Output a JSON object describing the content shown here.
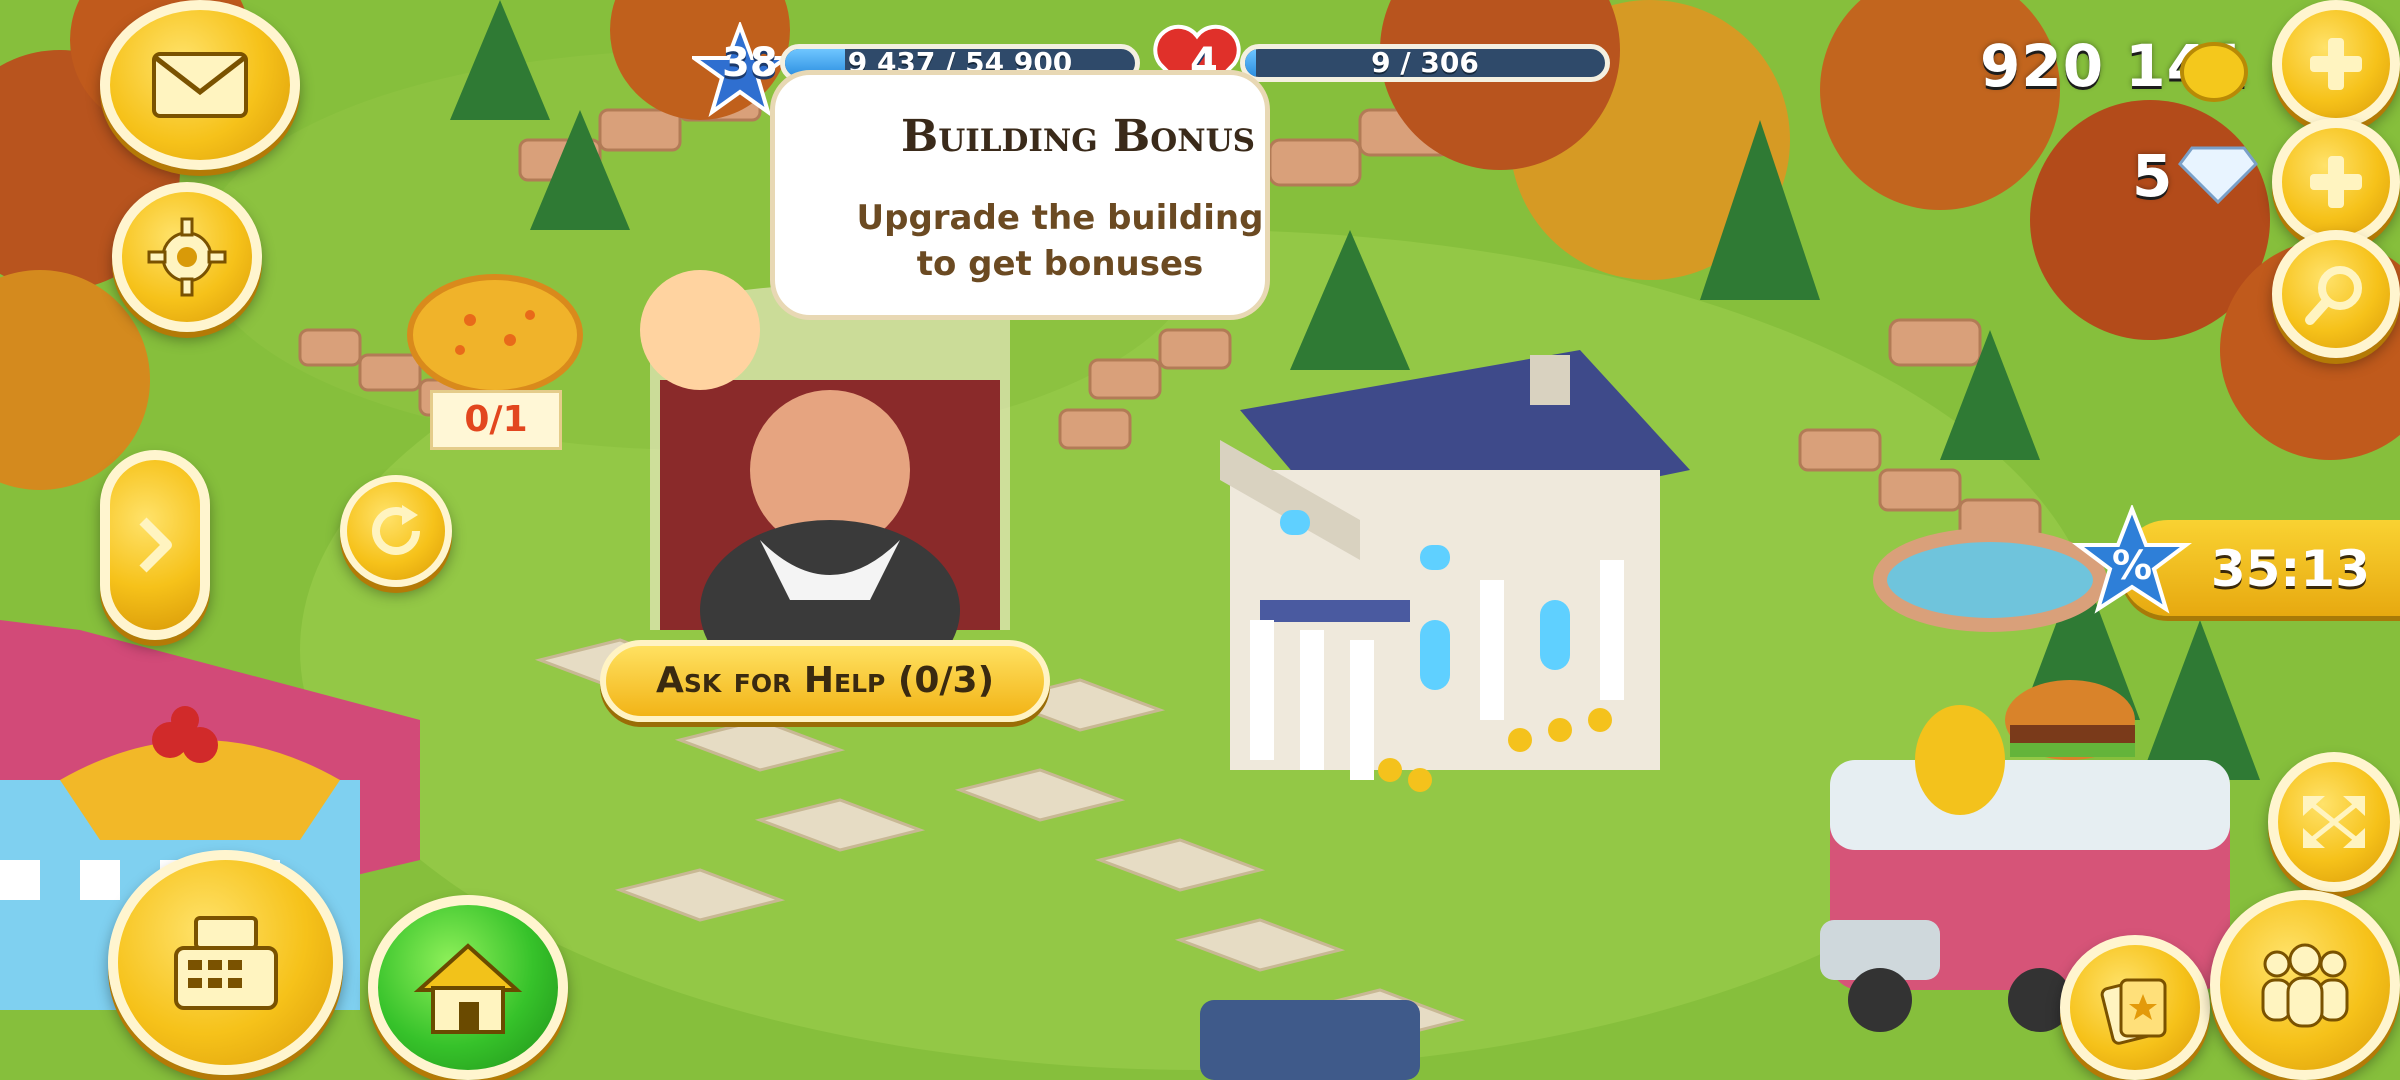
{
  "hud": {
    "level": "38",
    "xp_text": "9 437 / 54 900",
    "xp_progress": 0.172,
    "hearts": "4",
    "hearts_text": "9 / 306",
    "hearts_progress": 0.03,
    "coins": "920 141",
    "diamonds": "5"
  },
  "bubble": {
    "title": "Building Bonus",
    "text": "Upgrade the building\nto get bonuses"
  },
  "help_button": "Ask for Help (0/3)",
  "pizza_order": "0/1",
  "discount_timer": "35:13",
  "icons": [
    "mail-icon",
    "gear-icon",
    "arrow-right-icon",
    "cash-register-icon",
    "home-icon",
    "plus-icon",
    "magnifier-icon",
    "expand-icon",
    "friends-icon",
    "cards-icon",
    "refresh-icon"
  ],
  "colors": {
    "gold": "#f6c21a",
    "hud_blue": "#2f4a6a",
    "grass": "#7fb83a"
  }
}
